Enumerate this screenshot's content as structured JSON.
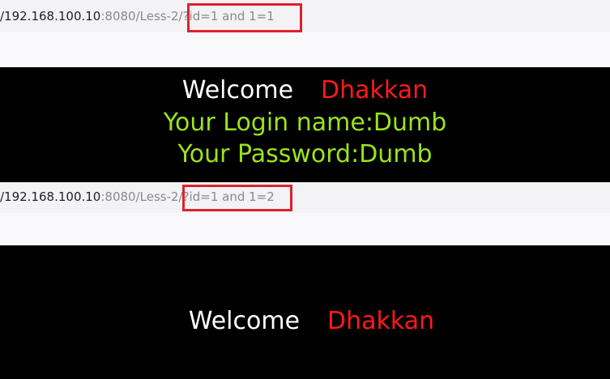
{
  "top": {
    "url": {
      "host": "/192.168.100.10",
      "rest": ":8080/Less-2/",
      "query": "?id=1 and 1=1"
    },
    "welcome_label": "Welcome",
    "welcome_name": "Dhakkan",
    "login_line": "Your Login name:Dumb",
    "password_line": "Your Password:Dumb"
  },
  "bottom": {
    "url": {
      "host": "/192.168.100.10",
      "rest": ":8080/Less-2/",
      "query": "?id=1 and 1=2"
    },
    "welcome_label": "Welcome",
    "welcome_name": "Dhakkan"
  },
  "colors": {
    "highlight_box": "#e0202a",
    "page_background": "#000000",
    "welcome_name": "#ff1a1a",
    "credentials": "#9ae31b"
  }
}
